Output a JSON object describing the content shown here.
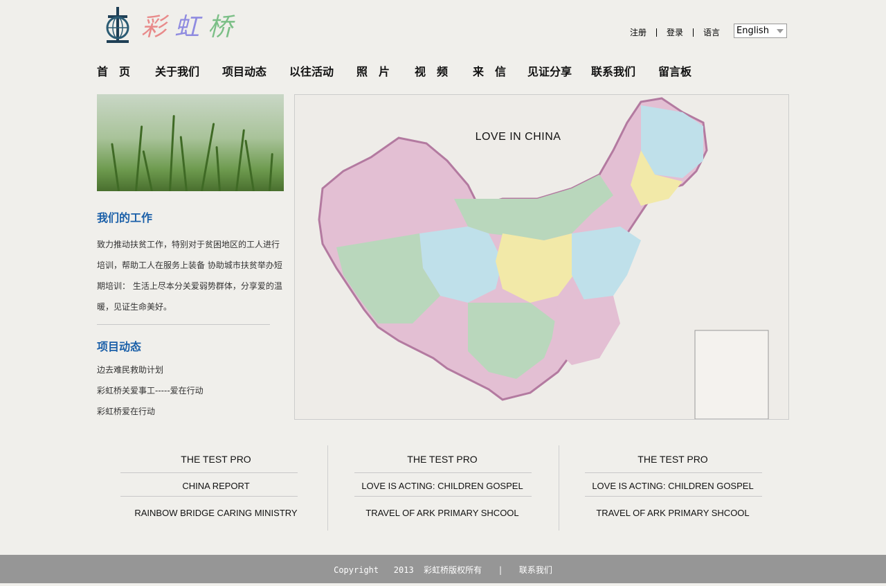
{
  "header": {
    "logo_text": [
      "彩",
      "虹",
      "桥"
    ],
    "register": "注册",
    "login": "登录",
    "language_label": "语言",
    "language_selected": "English"
  },
  "nav": [
    "首　页",
    "关于我们",
    "项目动态",
    "以往活动",
    "照　片",
    "视　频",
    "来　信",
    "见证分享",
    "联系我们",
    "留言板"
  ],
  "sidebar": {
    "work_title": "我们的工作",
    "work_text": "致力推动扶贫工作，特别对于贫困地区的工人进行培训，帮助工人在服务上装备 协助城市扶贫举办短期培训： 生活上尽本分关爱弱势群体，分享爱的温暖，见证生命美好。",
    "news_title": "项目动态",
    "news_items": [
      "边去难民救助计划",
      "彩虹桥关爱事工-----爱在行动",
      "彩虹桥爱在行动"
    ]
  },
  "map": {
    "title": "LOVE IN CHINA"
  },
  "columns": [
    {
      "title": "THE TEST PRO",
      "items": [
        "CHINA REPORT",
        "RAINBOW BRIDGE CARING MINISTRY"
      ]
    },
    {
      "title": "THE TEST PRO",
      "items": [
        "LOVE IS ACTING: CHILDREN GOSPEL",
        "TRAVEL OF ARK PRIMARY SHCOOL"
      ]
    },
    {
      "title": "THE TEST PRO",
      "items": [
        "LOVE IS ACTING: CHILDREN GOSPEL",
        "TRAVEL OF ARK PRIMARY SHCOOL"
      ]
    }
  ],
  "footer": {
    "copyright": "Copyright   2013  彩虹桥版权所有",
    "sep": "|",
    "contact": "联系我们"
  },
  "colors": {
    "accent": "#1a5fa8",
    "footer_bg": "#969696",
    "page_bg": "#f0efeb"
  }
}
